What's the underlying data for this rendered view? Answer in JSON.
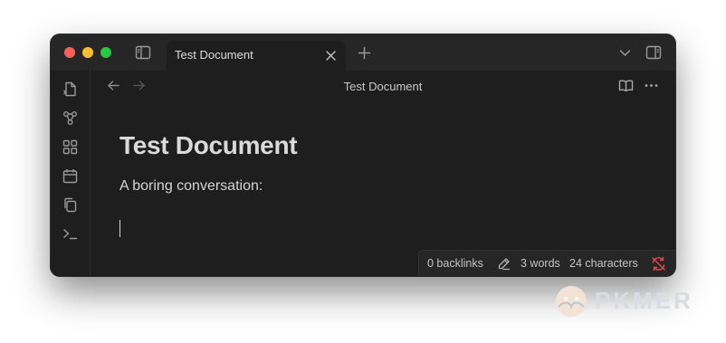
{
  "tab": {
    "title": "Test Document"
  },
  "header": {
    "title": "Test Document"
  },
  "document": {
    "heading": "Test Document",
    "text": "A boring conversation:"
  },
  "status": {
    "backlinks": "0 backlinks",
    "words": "3 words",
    "characters": "24 characters"
  },
  "watermark": {
    "text": "PKMER"
  },
  "icons": {
    "titlebar": [
      "sidebar-toggle-icon",
      "close-icon",
      "plus-icon",
      "chevron-down-icon",
      "right-sidebar-icon"
    ],
    "sidebar": [
      "file-switcher-icon",
      "graph-icon",
      "canvas-icon",
      "calendar-icon",
      "copy-icon",
      "terminal-icon"
    ],
    "header": [
      "arrow-left-icon",
      "arrow-right-icon",
      "book-open-icon",
      "more-options-icon"
    ],
    "status": [
      "pencil-icon",
      "sync-off-icon"
    ]
  },
  "colors": {
    "background": "#1e1e1e",
    "chrome": "#262626",
    "traffic_close": "#fe5f57",
    "traffic_minimize": "#febc2e",
    "traffic_maximize": "#28c840",
    "sync_error": "#e5484d"
  }
}
